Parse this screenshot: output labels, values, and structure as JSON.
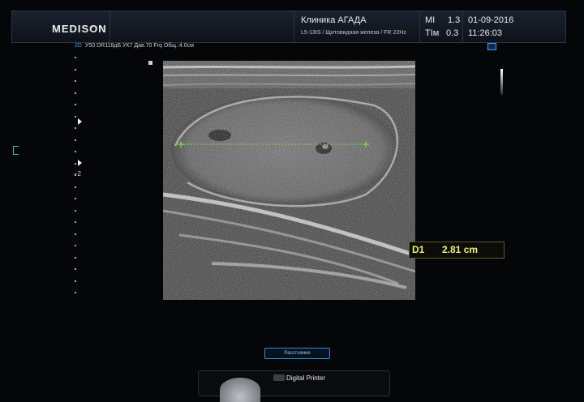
{
  "header": {
    "logo": "MEDISON",
    "logo_dot_colors": [
      "#d63a3a",
      "#3a7fd6",
      "#d6c23a",
      "#7a7a7a"
    ],
    "clinic_name": "Клиника АГАДА",
    "probe_info": "L5-13IS / Щитовидная железа / FR 22Hz",
    "mi_label": "MI",
    "mi_value": "1.3",
    "tim_label": "TIм",
    "tim_value": "0.3",
    "date": "01-09-2016",
    "time": "11:26:03"
  },
  "params": {
    "mode": "2D",
    "settings": "У50 DR118дБ УК7 Дав.70 Frq Общ.:4.0см"
  },
  "depth_scale": {
    "label": "2",
    "label_depth_cm": 2,
    "total_depth_cm": 4,
    "focus_depths_cm": [
      1.1,
      1.8
    ]
  },
  "measurement": {
    "label": "D1",
    "value": "2.81 cm",
    "line_color": "#7ddf3a",
    "text_color": "#f4f26a"
  },
  "bottom": {
    "button_label": "Расстояние",
    "printer_label": "Digital Printer"
  },
  "colors": {
    "accent_blue": "#3aa0ff",
    "marker_cyan": "#2fbfbf"
  }
}
